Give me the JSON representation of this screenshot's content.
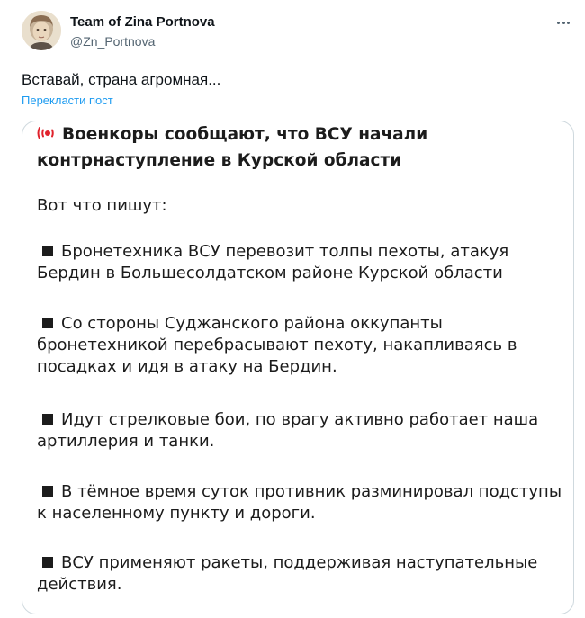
{
  "author": {
    "name": "Team of Zina Portnova",
    "handle": "@Zn_Portnova"
  },
  "tweet": {
    "text": "Вставай, страна агромная...",
    "translate_label": "Перекласти пост"
  },
  "media": {
    "title": "Военкоры сообщают, что ВСУ начали контрнаступление в Курской области",
    "intro": "Вот что пишут:",
    "bullets": [
      "Бронетехника ВСУ перевозит толпы пехоты, атакуя Бердин в Большесолдатском районе Курской области",
      "Со стороны Суджанского района оккупанты бронетехникой перебрасывают пехоту, накапливаясь в посадках и идя в атаку на Бердин.",
      "Идут стрелковые бои, по врагу активно работает наша артиллерия и танки.",
      "В тёмное время суток противник разминировал подступы к населенному пункту и дороги.",
      "ВСУ применяют ракеты, поддерживая наступательные действия."
    ]
  },
  "icons": {
    "title_icon": "siren-icon",
    "more": "more-horizontal-icon",
    "bullet": "black-square-icon"
  },
  "colors": {
    "link": "#1d9bf0",
    "secondary_text": "#536471",
    "card_border": "#cfd9de",
    "siren_red": "#e0222c"
  }
}
